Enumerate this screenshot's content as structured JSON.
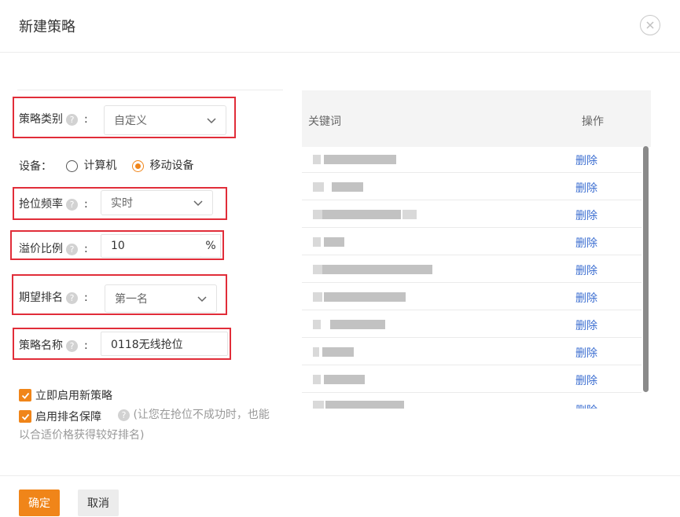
{
  "dialog": {
    "title": "新建策略",
    "close_icon": "close-circle-icon"
  },
  "form": {
    "strategy_type": {
      "label": "策略类别",
      "colon": ":",
      "value": "自定义"
    },
    "device": {
      "label": "设备：",
      "options": [
        {
          "label": "计算机",
          "selected": false
        },
        {
          "label": "移动设备",
          "selected": true
        }
      ]
    },
    "frequency": {
      "label": "抢位频率",
      "colon": ":",
      "value": "实时"
    },
    "premium_ratio": {
      "label": "溢价比例",
      "colon": ":",
      "value": "10",
      "suffix": "%"
    },
    "expected_rank": {
      "label": "期望排名",
      "colon": ":",
      "value": "第一名"
    },
    "strategy_name": {
      "label": "策略名称",
      "colon": ":",
      "value": "0118无线抢位"
    },
    "enable_now": {
      "label": "立即启用新策略",
      "checked": true
    },
    "rank_guarantee": {
      "label": "启用排名保障",
      "checked": true,
      "note_line1": "(让您在抢位不成功时，也能",
      "note_line2": "以合适价格获得较好排名)"
    }
  },
  "keyword_table": {
    "headers": {
      "keyword": "关键词",
      "action": "操作"
    },
    "rows": [
      {
        "action": "删除"
      },
      {
        "action": "删除"
      },
      {
        "action": "删除"
      },
      {
        "action": "删除"
      },
      {
        "action": "删除"
      },
      {
        "action": "删除"
      },
      {
        "action": "删除"
      },
      {
        "action": "删除"
      },
      {
        "action": "删除"
      },
      {
        "action": "删除"
      }
    ]
  },
  "footer": {
    "confirm_label": "确定",
    "cancel_label": "取消"
  },
  "colors": {
    "accent": "#f08519",
    "highlight_box": "#e12d39",
    "link": "#3d6fd1"
  }
}
